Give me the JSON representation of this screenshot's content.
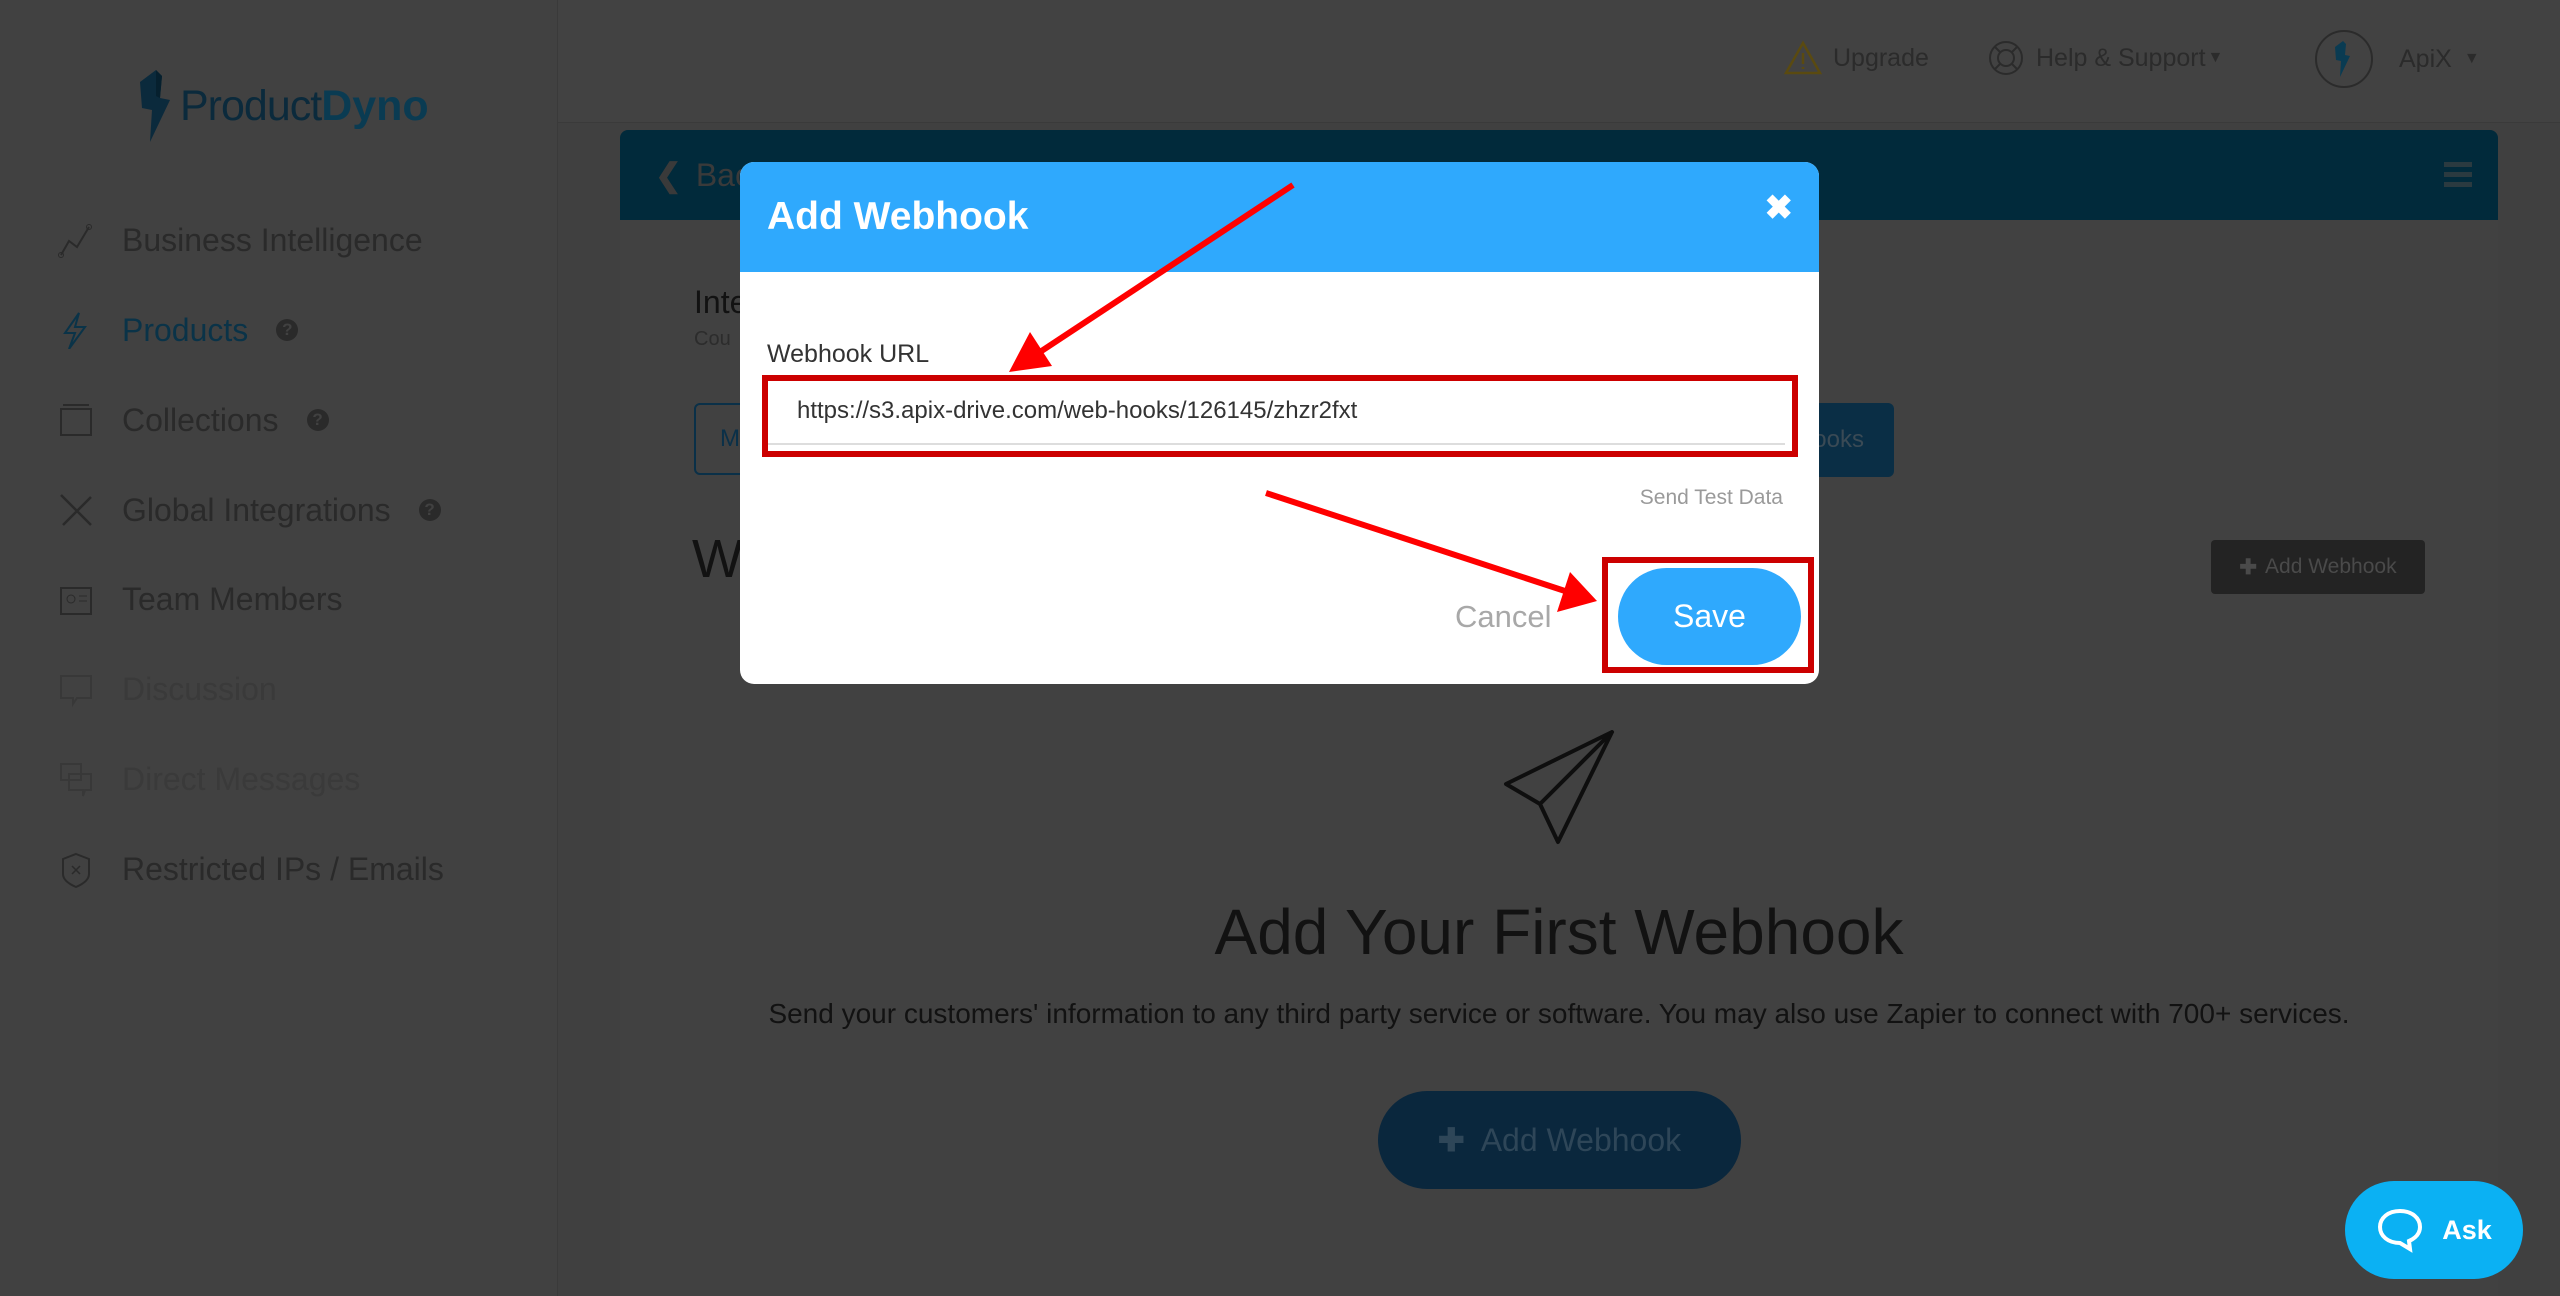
{
  "app": {
    "logo_part1": "Product",
    "logo_part2": "Dyno"
  },
  "sidebar": {
    "items": [
      {
        "label": "Business Intelligence",
        "icon": "line-chart-icon",
        "active": false
      },
      {
        "label": "Products",
        "icon": "bolt-icon",
        "active": true,
        "help": "?"
      },
      {
        "label": "Collections",
        "icon": "collection-icon",
        "help": "?"
      },
      {
        "label": "Global Integrations",
        "icon": "tools-icon",
        "help": "?"
      },
      {
        "label": "Team Members",
        "icon": "id-card-icon"
      },
      {
        "label": "Discussion",
        "icon": "chat-icon",
        "disabled": true
      },
      {
        "label": "Direct Messages",
        "icon": "messages-icon",
        "disabled": true
      },
      {
        "label": "Restricted IPs / Emails",
        "icon": "shield-x-icon"
      }
    ]
  },
  "topbar": {
    "upgrade": "Upgrade",
    "help": "Help & Support",
    "user": "ApiX"
  },
  "background": {
    "back": "Back",
    "section_title": "Inte",
    "section_sub": "Cou",
    "tab_left": "M",
    "tab_right": "ooks",
    "heading": "W",
    "add_webhook_small": "Add Webhook",
    "empty_title": "Add Your First Webhook",
    "empty_text": "Send your customers' information to any third party service or software. You may also use Zapier to connect with 700+ services.",
    "add_webhook_big": "Add Webhook"
  },
  "modal": {
    "title": "Add Webhook",
    "close": "✖",
    "label": "Webhook URL",
    "url_value": "https://s3.apix-drive.com/web-hooks/126145/zhzr2fxt",
    "send_test": "Send Test Data",
    "cancel": "Cancel",
    "save": "Save"
  },
  "chat": {
    "label": "Ask"
  },
  "colors": {
    "modal_header": "#2fa9fd",
    "save": "#2fa9fd",
    "highlight": "#cc0000",
    "arrow": "#ff0000",
    "chat": "#0bb1f3"
  }
}
